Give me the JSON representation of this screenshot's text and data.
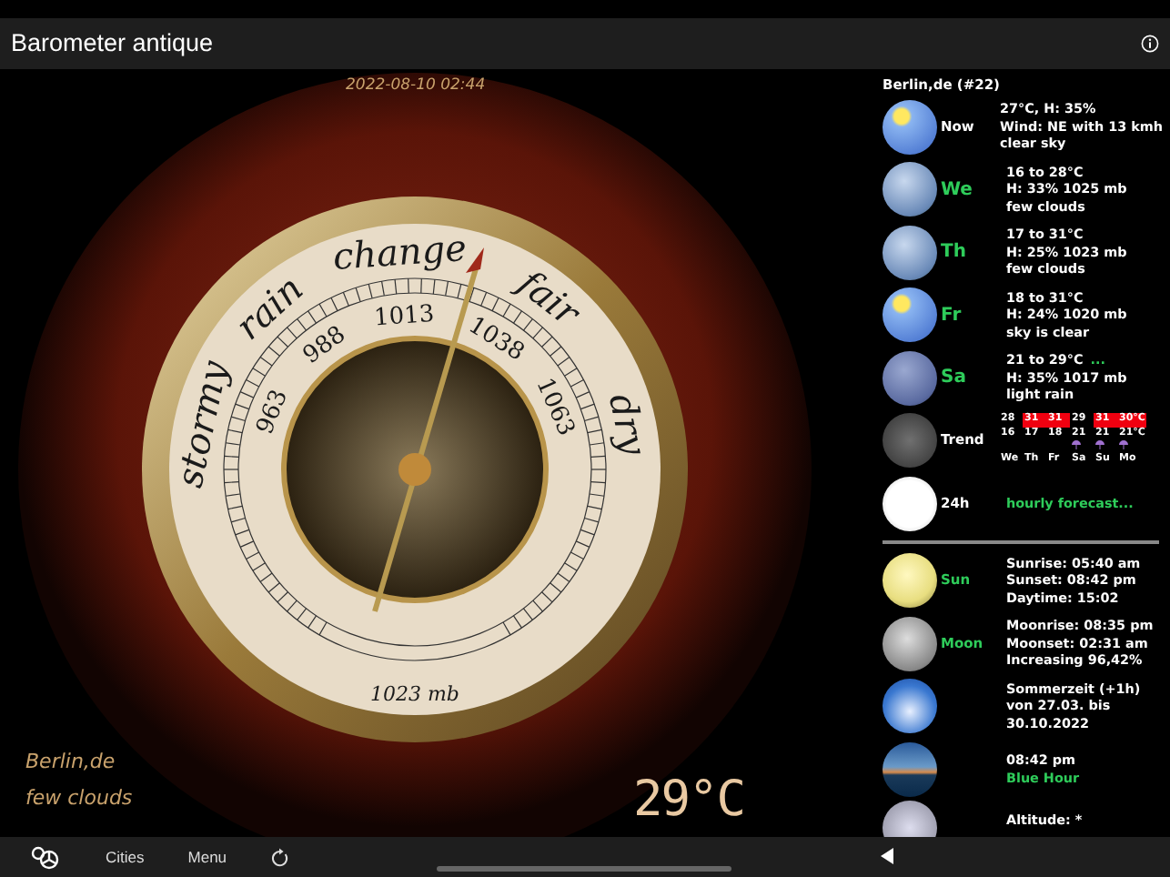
{
  "window": {
    "title": "Barometer antique"
  },
  "barometer": {
    "timestamp": "2022-08-10 02:44",
    "words": [
      "stormy",
      "rain",
      "change",
      "fair",
      "dry"
    ],
    "scale": [
      "963",
      "988",
      "1013",
      "1038",
      "1063"
    ],
    "reading": "1023 mb",
    "location": "Berlin,de",
    "condition": "few clouds",
    "temperature": "29°C"
  },
  "forecast": {
    "title": "Berlin,de (#22)",
    "rows": [
      {
        "kind": "weather",
        "label": "Now",
        "accent": false,
        "lines": [
          "27°C, H: 35%",
          "Wind: NE with 13 kmh",
          "clear sky"
        ]
      },
      {
        "kind": "weather",
        "label": "We",
        "accent": true,
        "lines": [
          "16 to 28°C",
          "H: 33% 1025 mb",
          "few clouds"
        ]
      },
      {
        "kind": "weather",
        "label": "Th",
        "accent": true,
        "lines": [
          "17 to 31°C",
          "H: 25% 1023 mb",
          "few clouds"
        ]
      },
      {
        "kind": "weather",
        "label": "Fr",
        "accent": true,
        "lines": [
          "18 to 31°C",
          "H: 24% 1020 mb",
          "sky is clear"
        ]
      },
      {
        "kind": "weather",
        "label": "Sa",
        "accent": true,
        "lines": [
          "21 to 29°C",
          "H: 35% 1017 mb",
          "light rain"
        ],
        "more": "..."
      },
      {
        "kind": "trend",
        "label": "Trend",
        "accent": false,
        "days": [
          {
            "day": "We",
            "high": "28",
            "low": "16",
            "hot": false,
            "rain": false
          },
          {
            "day": "Th",
            "high": "31",
            "low": "17",
            "hot": true,
            "rain": false
          },
          {
            "day": "Fr",
            "high": "31",
            "low": "18",
            "hot": true,
            "rain": false
          },
          {
            "day": "Sa",
            "high": "29",
            "low": "21",
            "hot": false,
            "rain": true
          },
          {
            "day": "Su",
            "high": "31",
            "low": "21",
            "hot": true,
            "rain": true
          },
          {
            "day": "Mo",
            "high": "30°C",
            "low": "21°C",
            "hot": true,
            "rain": true
          }
        ]
      },
      {
        "kind": "link",
        "label": "24h",
        "accent": false,
        "link": "hourly forecast..."
      },
      {
        "kind": "divider"
      },
      {
        "kind": "weather",
        "label": "Sun",
        "accent": true,
        "lines": [
          "Sunrise: 05:40 am",
          "Sunset: 08:42 pm",
          "Daytime: 15:02"
        ]
      },
      {
        "kind": "weather",
        "label": "Moon",
        "accent": true,
        "lines": [
          "Moonrise: 08:35 pm",
          "Moonset: 02:31 am",
          "Increasing 96,42%"
        ]
      },
      {
        "kind": "weather",
        "lines": [
          "Sommerzeit (+1h)",
          "von 27.03. bis",
          "30.10.2022"
        ]
      },
      {
        "kind": "weather",
        "lines": [
          "08:42 pm"
        ],
        "green_line": "Blue Hour"
      },
      {
        "kind": "weather",
        "lines": [
          "Altitude: *"
        ]
      }
    ]
  },
  "toolbar": {
    "items": [
      "Cities",
      "Menu"
    ]
  }
}
